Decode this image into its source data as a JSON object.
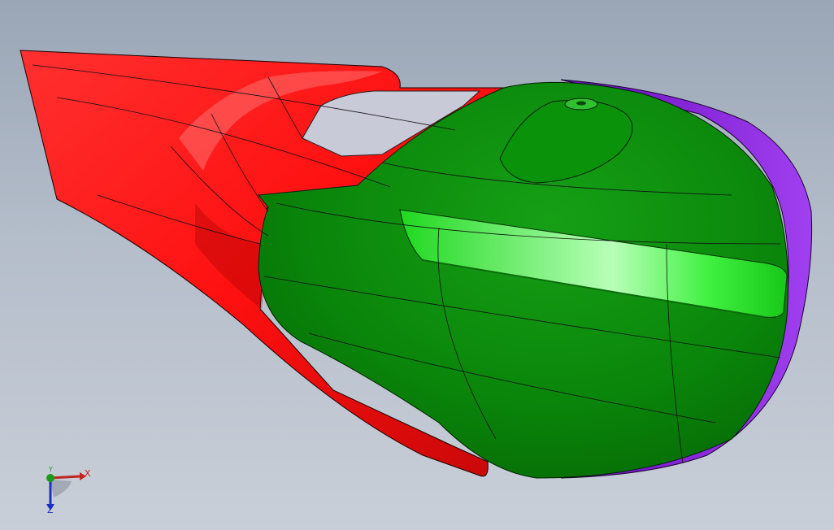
{
  "viewport": {
    "background_top": "#9aa6b6",
    "background_bottom": "#c9cfd8"
  },
  "model": {
    "parts": [
      {
        "name": "tail-fairing",
        "color": "#ff1010"
      },
      {
        "name": "nose-body",
        "color": "#0a8a0a"
      },
      {
        "name": "headlight-strip",
        "color": "#1fe01f"
      },
      {
        "name": "rear-cap",
        "color": "#8a16e0"
      },
      {
        "name": "canopy-window",
        "color": "#c9cad8"
      }
    ]
  },
  "triad": {
    "x_label": "X",
    "y_label": "Y",
    "z_label": "Z",
    "x_color": "#c0241c",
    "y_color": "#1a9a1a",
    "z_color": "#1d2fc0"
  }
}
